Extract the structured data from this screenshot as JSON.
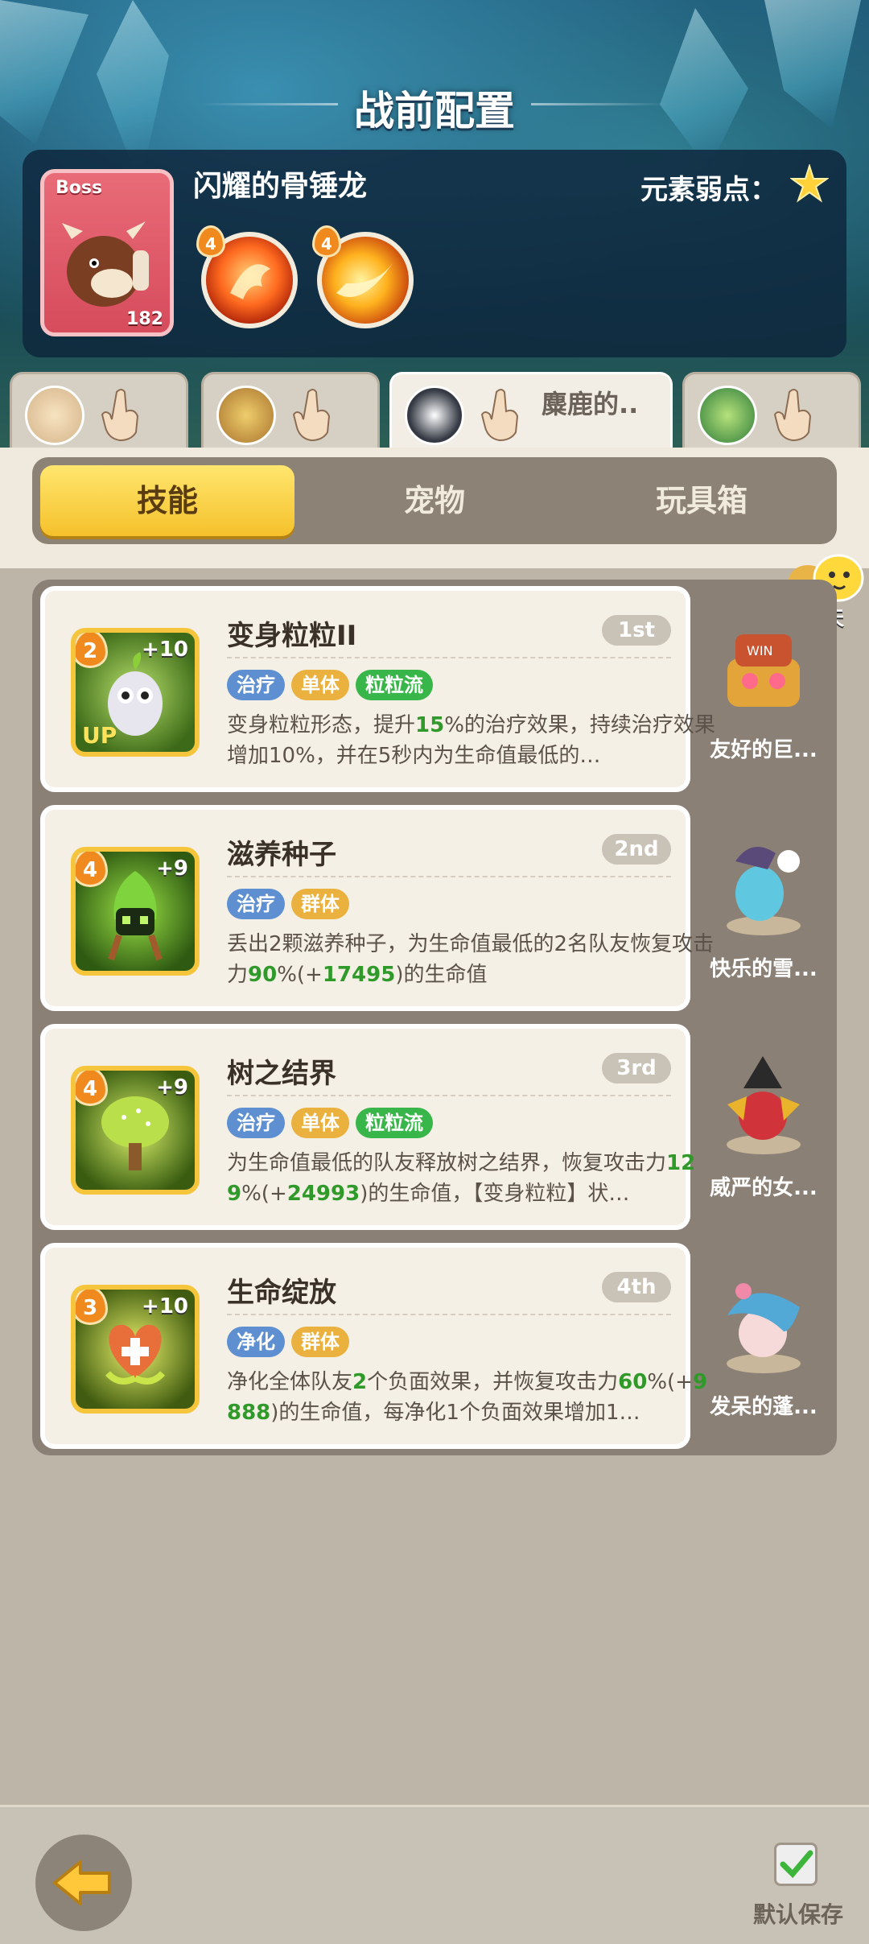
{
  "header": {
    "title": "战前配置"
  },
  "boss": {
    "tag": "Boss",
    "level": "182",
    "name": "闪耀的骨锤龙",
    "weakness_label": "元素弱点：",
    "weakness_icon": "star-icon",
    "skills": [
      {
        "level": "4",
        "icon": "fire-phoenix-icon"
      },
      {
        "level": "4",
        "icon": "flame-slash-icon"
      }
    ]
  },
  "team_tabs": [
    {
      "name": "",
      "icon": "pet-cat-icon"
    },
    {
      "name": "",
      "icon": "pet-owl-icon"
    },
    {
      "name": "麋鹿的..",
      "icon": "pet-panda-icon"
    },
    {
      "name": "",
      "icon": "pet-turtle-icon"
    }
  ],
  "segment": {
    "skills": "技能",
    "pets": "宠物",
    "toys": "玩具箱"
  },
  "chat": {
    "label": "聊天"
  },
  "skills": [
    {
      "name": "变身粒粒II",
      "rank": "1st",
      "level": "2",
      "plus": "+10",
      "up": "UP",
      "tags": [
        "治疗",
        "单体",
        "粒粒流"
      ],
      "desc_a": "变身粒粒形态，提升",
      "num1": "15",
      "desc_b": "%的治疗效果，持续治疗效果增加10%，并在5秒内为生命值最低的…",
      "pet": "友好的巨..."
    },
    {
      "name": "滋养种子",
      "rank": "2nd",
      "level": "4",
      "plus": "+9",
      "tags": [
        "治疗",
        "群体"
      ],
      "desc_a": "丢出2颗滋养种子，为生命值最低的2名队友恢复攻击力",
      "num1": "90",
      "desc_b": "%(+",
      "num2": "17495",
      "desc_c": ")的生命值",
      "pet": "快乐的雪..."
    },
    {
      "name": "树之结界",
      "rank": "3rd",
      "level": "4",
      "plus": "+9",
      "tags": [
        "治疗",
        "单体",
        "粒粒流"
      ],
      "desc_a": "为生命值最低的队友释放树之结界，恢复攻击力",
      "num1": "129",
      "desc_b": "%(+",
      "num2": "24993",
      "desc_c": ")的生命值，【变身粒粒】状…",
      "pet": "威严的女..."
    },
    {
      "name": "生命绽放",
      "rank": "4th",
      "level": "3",
      "plus": "+10",
      "tags": [
        "净化",
        "群体"
      ],
      "desc_a": "净化全体队友",
      "num1": "2",
      "desc_b": "个负面效果，并恢复攻击力",
      "num2": "60",
      "desc_c": "%(+",
      "num3": "9888",
      "desc_d": ")的生命值，每净化1个负面效果增加1…",
      "pet": "发呆的蓬..."
    }
  ],
  "footer": {
    "save_label": "默认保存"
  }
}
